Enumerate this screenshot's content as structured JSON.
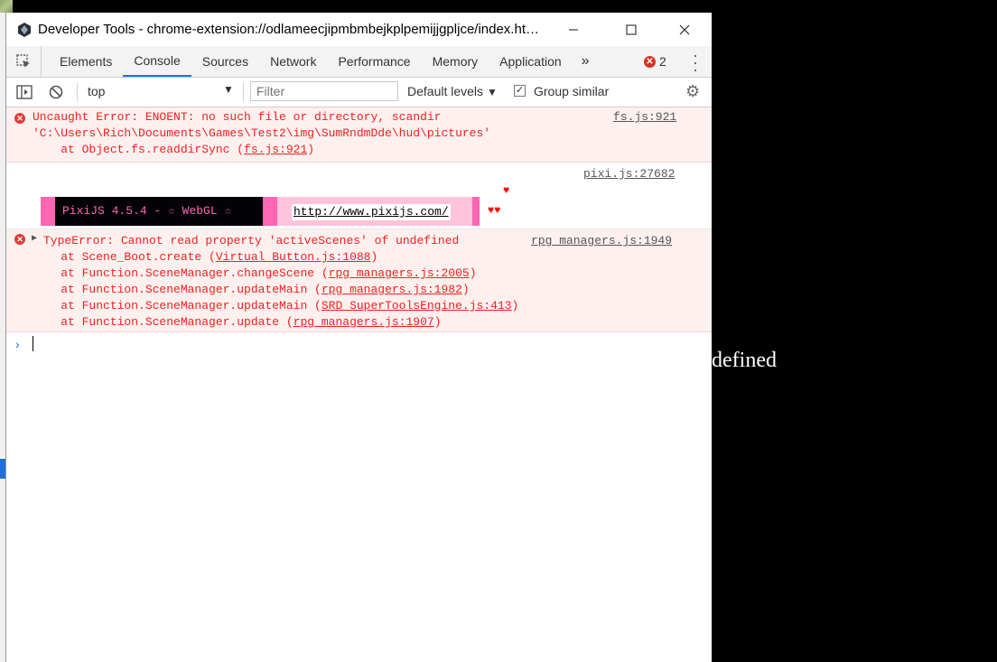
{
  "window": {
    "title": "Developer Tools - chrome-extension://odlameecjipmbmbejkplpemijjgpljce/index.ht…",
    "minimize_icon": "minimize-icon",
    "maximize_icon": "maximize-icon",
    "close_icon": "close-icon"
  },
  "background": {
    "partial_text": "defined"
  },
  "tabs": {
    "items": [
      "Elements",
      "Console",
      "Sources",
      "Network",
      "Performance",
      "Memory",
      "Application"
    ],
    "active": "Console",
    "more": "»",
    "error_count": "2"
  },
  "toolbar": {
    "context": "top",
    "filter_placeholder": "Filter",
    "levels": "Default levels",
    "group_similar": "Group similar",
    "group_similar_checked": true
  },
  "messages": {
    "error1": {
      "line1": "Uncaught Error: ENOENT: no such file or directory, scandir",
      "line2": "'C:\\Users\\Rich\\Documents\\Games\\Test2\\img\\SumRndmDde\\hud\\pictures'",
      "line3_prefix": "    at Object.fs.readdirSync (",
      "line3_link": "fs.js:921",
      "line3_suffix": ")",
      "source": "fs.js:921"
    },
    "log": {
      "source": "pixi.js:27682",
      "banner_text": "PixiJS 4.5.4 - ☆ WebGL ☆",
      "banner_url": "http://www.pixijs.com/",
      "hearts_top": "♥",
      "hearts_bottom": "♥♥"
    },
    "error2": {
      "line1": "TypeError: Cannot read property 'activeScenes' of undefined",
      "source": "rpg_managers.js:1949",
      "stack": [
        {
          "prefix": "    at Scene_Boot.create (",
          "link": "Virtual_Button.js:1088",
          "suffix": ")"
        },
        {
          "prefix": "    at Function.SceneManager.changeScene (",
          "link": "rpg_managers.js:2005",
          "suffix": ")"
        },
        {
          "prefix": "    at Function.SceneManager.updateMain (",
          "link": "rpg_managers.js:1982",
          "suffix": ")"
        },
        {
          "prefix": "    at Function.SceneManager.updateMain (",
          "link": "SRD_SuperToolsEngine.js:413",
          "suffix": ")"
        },
        {
          "prefix": "    at Function.SceneManager.update (",
          "link": "rpg_managers.js:1907",
          "suffix": ")"
        }
      ]
    }
  },
  "colors": {
    "error_text": "#f0221c",
    "error_bg": "#fff0f0",
    "accent": "#1a73e8",
    "pixi_pink": "#ff66b3"
  }
}
